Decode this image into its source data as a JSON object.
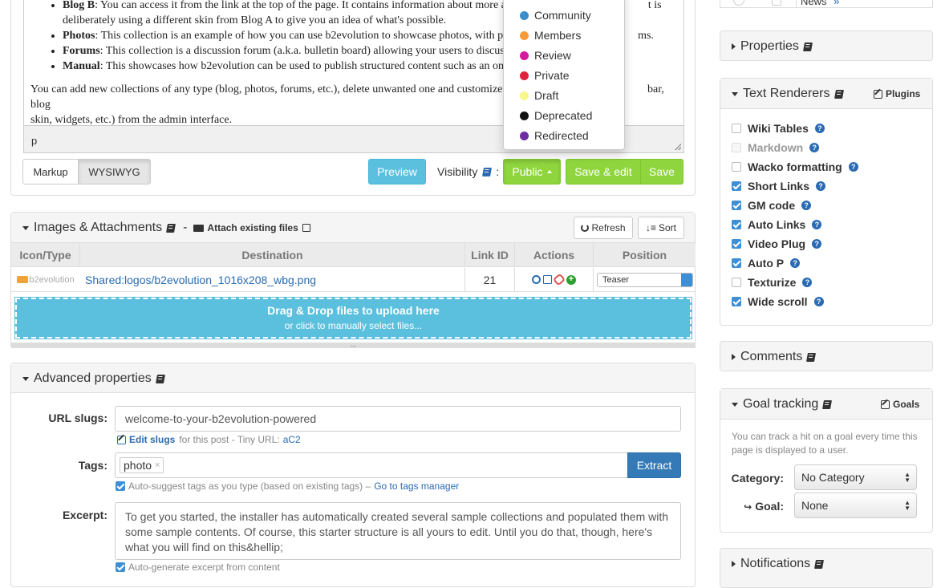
{
  "editor": {
    "items": [
      {
        "bold": "Blog B",
        "text": ": You can access it from the link at the top of the page. It contains information about more ad",
        "tail": "t is"
      },
      {
        "bold": "",
        "text": "deliberately using a different skin from Blog A to give you an idea of what's possible.",
        "tail": ""
      },
      {
        "bold": "Photos",
        "text": ": This collection is an example of how you can use b2evolution to showcase photos, with phot",
        "tail": "ms."
      },
      {
        "bold": "Forums",
        "text": ": This collection is a discussion forum (a.k.a. bulletin board) allowing your users to discuss a",
        "tail": ""
      },
      {
        "bold": "Manual",
        "text": ": This showcases how b2evolution can be used to publish structured content such as an onli",
        "tail": ""
      }
    ],
    "paragraph_1": "You can add new collections of any type (blog, photos, forums, etc.), delete unwanted one and customize exi",
    "paragraph_1_tail": "bar, blog",
    "paragraph_2": "skin, widgets, etc.) from the admin interface.",
    "status_path": "p",
    "markup_label": "Markup",
    "wysiwyg_label": "WYSIWYG",
    "preview_label": "Preview",
    "visibility_label": "Visibility",
    "visibility_colon": ":",
    "public_label": "Public",
    "save_edit_label": "Save & edit",
    "save_label": "Save"
  },
  "visibility_menu": [
    {
      "label": "Community",
      "color": "#3a8ec9"
    },
    {
      "label": "Members",
      "color": "#f79b38"
    },
    {
      "label": "Review",
      "color": "#d6189e"
    },
    {
      "label": "Private",
      "color": "#e0213b"
    },
    {
      "label": "Draft",
      "color": "#f7f78a"
    },
    {
      "label": "Deprecated",
      "color": "#111111"
    },
    {
      "label": "Redirected",
      "color": "#6b2fa2"
    }
  ],
  "attachments": {
    "title": "Images & Attachments",
    "dash": "-",
    "attach_existing": "Attach existing files",
    "refresh_label": "Refresh",
    "sort_label": "Sort",
    "columns": [
      "Icon/Type",
      "Destination",
      "Link ID",
      "Actions",
      "Position"
    ],
    "row": {
      "icon_text": "b2evolution",
      "destination": "Shared:logos/b2evolution_1016x208_wbg.png",
      "link_id": "21",
      "position": "Teaser"
    },
    "dropzone_title": "Drag & Drop files to upload here",
    "dropzone_sub": "or click to manually select files...",
    "grip": "..."
  },
  "advanced": {
    "title": "Advanced properties",
    "url_slugs_label": "URL slugs:",
    "url_slug_value": "welcome-to-your-b2evolution-powered",
    "edit_slugs_label": "Edit slugs",
    "slug_help": "for this post - Tiny URL:",
    "tiny_url": "aC2",
    "tags_label": "Tags:",
    "tag_value": "photo",
    "tag_remove": "×",
    "extract_label": "Extract",
    "tags_help": "Auto-suggest tags as you type (based on existing tags) –",
    "tags_manager_link": "Go to tags manager",
    "excerpt_label": "Excerpt:",
    "excerpt_value": "To get you started, the installer has automatically created several sample collections and populated them with some sample contents. Of course, this starter structure is all yours to edit. Until you do that, though, here's what you will find on this&hellip;",
    "excerpt_help": "Auto-generate excerpt from content"
  },
  "sidebar": {
    "news_label": "News",
    "news_arrow": "»",
    "properties_title": "Properties",
    "text_renderers_title": "Text Renderers",
    "plugins_label": "Plugins",
    "renderers": [
      {
        "label": "Wiki Tables",
        "state": "off"
      },
      {
        "label": "Markdown",
        "state": "disabled"
      },
      {
        "label": "Wacko formatting",
        "state": "off"
      },
      {
        "label": "Short Links",
        "state": "on"
      },
      {
        "label": "GM code",
        "state": "on"
      },
      {
        "label": "Auto Links",
        "state": "on"
      },
      {
        "label": "Video Plug",
        "state": "on"
      },
      {
        "label": "Auto P",
        "state": "on"
      },
      {
        "label": "Texturize",
        "state": "off"
      },
      {
        "label": "Wide scroll",
        "state": "on"
      }
    ],
    "help_glyph": "?",
    "comments_title": "Comments",
    "goal_title": "Goal tracking",
    "goals_label": "Goals",
    "goal_help": "You can track a hit on a goal every time this page is displayed to a user.",
    "category_label": "Category:",
    "category_value": "No Category",
    "goal_label": "Goal:",
    "goal_arrow": "↪",
    "goal_value": "None",
    "notifications_title": "Notifications"
  },
  "colors": {
    "green": "#8fd63e",
    "blue": "#5bc0de",
    "primary": "#337ab7",
    "link": "#2a6bb3"
  }
}
